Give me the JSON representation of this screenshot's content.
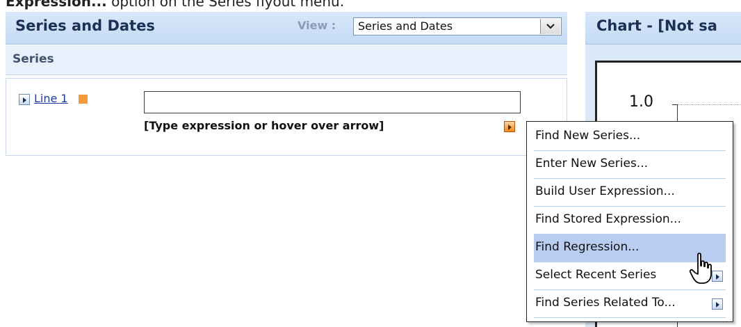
{
  "caption": {
    "bold_text": "Expression...",
    "rest_text": " option on the Series flyout menu."
  },
  "left_panel": {
    "title": "Series and Dates",
    "view_label": "View :",
    "view_selected": "Series and Dates",
    "section_label": "Series",
    "series": {
      "name": "Line 1",
      "swatch_color": "#f39a3a",
      "expression_value": "",
      "hint": "[Type expression or hover over arrow]"
    }
  },
  "right_panel": {
    "title": "Chart - [Not sa",
    "y_tick": "1.0"
  },
  "flyout_menu": {
    "items": [
      {
        "label": "Find New Series...",
        "has_submenu": false,
        "hovered": false
      },
      {
        "label": "Enter New Series...",
        "has_submenu": false,
        "hovered": false
      },
      {
        "label": "Build User Expression...",
        "has_submenu": false,
        "hovered": false
      },
      {
        "label": "Find Stored Expression...",
        "has_submenu": false,
        "hovered": false
      },
      {
        "label": "Find Regression...",
        "has_submenu": false,
        "hovered": true
      },
      {
        "label": "Select Recent Series",
        "has_submenu": true,
        "hovered": false
      },
      {
        "label": "Find Series Related To...",
        "has_submenu": true,
        "hovered": false
      }
    ]
  },
  "colors": {
    "accent_orange": "#f39a3a",
    "header_blue": "#c4daf4",
    "hover_blue": "#b8cdf0",
    "link_blue": "#1f3e9c"
  },
  "icons": {
    "expand": "triangle-right-icon",
    "flyout": "orange-arrow-icon",
    "dropdown": "chevron-down-icon",
    "cursor": "hand-pointer-icon"
  }
}
